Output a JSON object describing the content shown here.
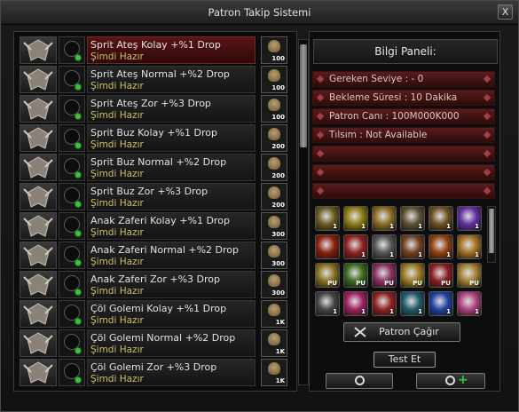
{
  "window": {
    "title": "Patron Takip Sistemi",
    "close_label": "X"
  },
  "bosses": [
    {
      "name": "Sprit Ateş Kolay +%1 Drop",
      "status": "Şimdi Hazır",
      "count": "100",
      "selected": true
    },
    {
      "name": "Sprit Ateş Normal +%2 Drop",
      "status": "Şimdi Hazır",
      "count": "100",
      "selected": false
    },
    {
      "name": "Sprit Ateş Zor +%3 Drop",
      "status": "Şimdi Hazır",
      "count": "100",
      "selected": false
    },
    {
      "name": "Sprit Buz Kolay +%1 Drop",
      "status": "Şimdi Hazır",
      "count": "200",
      "selected": false
    },
    {
      "name": "Sprit Buz Normal +%2 Drop",
      "status": "Şimdi Hazır",
      "count": "200",
      "selected": false
    },
    {
      "name": "Sprit Buz Zor +%3 Drop",
      "status": "Şimdi Hazır",
      "count": "200",
      "selected": false
    },
    {
      "name": "Anak Zaferi Kolay +%1 Drop",
      "status": "Şimdi Hazır",
      "count": "300",
      "selected": false
    },
    {
      "name": "Anak Zaferi Normal +%2 Drop",
      "status": "Şimdi Hazır",
      "count": "300",
      "selected": false
    },
    {
      "name": "Anak Zaferi Zor +%3 Drop",
      "status": "Şimdi Hazır",
      "count": "300",
      "selected": false
    },
    {
      "name": "Çöl Golemi Kolay +%1 Drop",
      "status": "Şimdi Hazır",
      "count": "1K",
      "selected": false
    },
    {
      "name": "Çöl Golemi Normal +%2 Drop",
      "status": "Şimdi Hazır",
      "count": "1K",
      "selected": false
    },
    {
      "name": "Çöl Golemi Zor +%3 Drop",
      "status": "Şimdi Hazır",
      "count": "1K",
      "selected": false
    }
  ],
  "info_panel": {
    "title": "Bilgi Paneli:",
    "lines": [
      "Gereken Seviye : - 0",
      "Bekleme Süresi : 10 Dakika",
      "Patron Canı : 100M000K000",
      "Tılsım : Not Available",
      "",
      "",
      ""
    ]
  },
  "rewards": [
    {
      "icon": "gold-amulet-icon",
      "badge": "1",
      "color": "#6a5a20"
    },
    {
      "icon": "yellow-potion-icon",
      "badge": "1",
      "color": "#8a7a10"
    },
    {
      "icon": "gold-scroll-icon",
      "badge": "1",
      "color": "#8a6a20"
    },
    {
      "icon": "star-scroll-icon",
      "badge": "1",
      "color": "#5a5030"
    },
    {
      "icon": "gold-chest-icon",
      "badge": "1",
      "color": "#6a5020"
    },
    {
      "icon": "purple-gem-icon",
      "badge": "1",
      "color": "#6030a0"
    },
    {
      "icon": "red-orb-icon",
      "badge": "",
      "color": "#8a2010"
    },
    {
      "icon": "red-rune-icon",
      "badge": "1",
      "color": "#902020"
    },
    {
      "icon": "anvil-icon",
      "badge": "1",
      "color": "#555555"
    },
    {
      "icon": "wood-chest-icon",
      "badge": "1",
      "color": "#704020"
    },
    {
      "icon": "fire-crest-icon",
      "badge": "1",
      "color": "#904010"
    },
    {
      "icon": "gold-shield-icon",
      "badge": "1",
      "color": "#a07020"
    },
    {
      "icon": "gold-arrow-icon",
      "badge": "PU",
      "color": "#8a7020"
    },
    {
      "icon": "green-arrow-icon",
      "badge": "PU",
      "color": "#3a6a20"
    },
    {
      "icon": "pink-arrow-icon",
      "badge": "PU",
      "color": "#8a3060"
    },
    {
      "icon": "gold-badge-icon",
      "badge": "PU",
      "color": "#9a7a20"
    },
    {
      "icon": "red-badge-icon",
      "badge": "PU",
      "color": "#8a2020"
    },
    {
      "icon": "gold-crest-icon",
      "badge": "PU",
      "color": "#a08030"
    },
    {
      "icon": "white-cross-icon",
      "badge": "1",
      "color": "#444444"
    },
    {
      "icon": "pink-gem-icon",
      "badge": "1",
      "color": "#a02060"
    },
    {
      "icon": "red-s-scroll-icon",
      "badge": "1",
      "color": "#902020"
    },
    {
      "icon": "teal-ore-icon",
      "badge": "1",
      "color": "#205a6a"
    },
    {
      "icon": "blue-ore-icon",
      "badge": "1",
      "color": "#2040a0"
    },
    {
      "icon": "pink-swirl-icon",
      "badge": "1",
      "color": "#b04080"
    }
  ],
  "buttons": {
    "call_boss": "Patron Çağır",
    "test": "Test Et"
  }
}
